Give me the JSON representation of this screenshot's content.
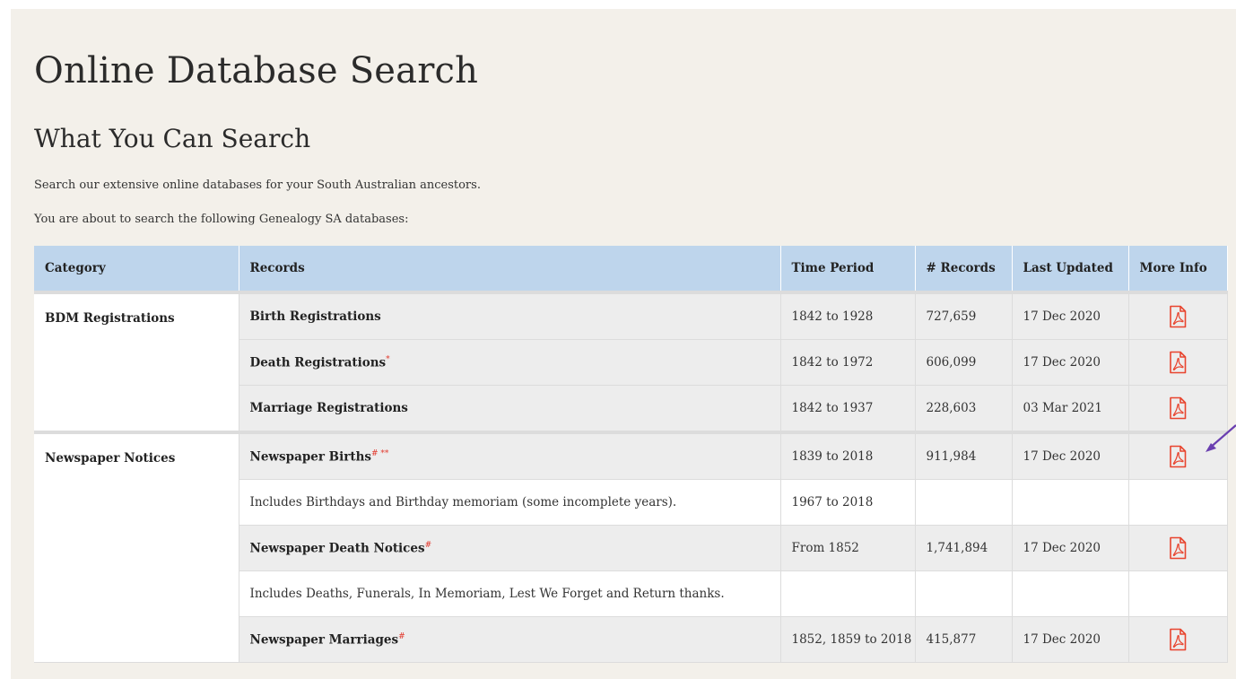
{
  "page": {
    "title": "Online Database Search",
    "subtitle": "What You Can Search",
    "intro_1": "Search our extensive online databases for your South Australian ancestors.",
    "intro_2": "You are about to search the following Genealogy SA databases:"
  },
  "table": {
    "headers": {
      "category": "Category",
      "records": "Records",
      "time_period": "Time Period",
      "num_records": "# Records",
      "last_updated": "Last Updated",
      "more_info": "More Info"
    },
    "groups": [
      {
        "category": "BDM Registrations",
        "rows": [
          {
            "record": "Birth Registrations",
            "marks": "",
            "period": "1842 to 1928",
            "count": "727,659",
            "updated": "17 Dec 2020",
            "pdf": true
          },
          {
            "record": "Death Registrations",
            "marks": "*",
            "period": "1842 to 1972",
            "count": "606,099",
            "updated": "17 Dec 2020",
            "pdf": true
          },
          {
            "record": "Marriage Registrations",
            "marks": "",
            "period": "1842 to 1937",
            "count": "228,603",
            "updated": "03 Mar 2021",
            "pdf": true
          }
        ]
      },
      {
        "category": "Newspaper Notices",
        "rows": [
          {
            "record": "Newspaper Births",
            "marks": "# **",
            "period": "1839 to 2018",
            "count": "911,984",
            "updated": "17 Dec 2020",
            "pdf": true
          },
          {
            "note": "Includes Birthdays and Birthday memoriam (some incomplete years).",
            "period": "1967 to 2018"
          },
          {
            "record": "Newspaper Death Notices",
            "marks": "#",
            "period": "From 1852",
            "count": "1,741,894",
            "updated": "17 Dec 2020",
            "pdf": true
          },
          {
            "note": "Includes Deaths, Funerals, In Memoriam, Lest We Forget and Return thanks.",
            "period": ""
          },
          {
            "record": "Newspaper Marriages",
            "marks": "#",
            "period": "1852, 1859 to 2018",
            "count": "415,877",
            "updated": "17 Dec 2020",
            "pdf": true
          }
        ]
      }
    ]
  },
  "icons": {
    "more_info": "pdf-icon",
    "annotation": "arrow-icon"
  },
  "colors": {
    "header_bg": "#bed5ec",
    "pdf_red": "#e8452f",
    "arrow": "#6a3fb0",
    "panel_bg": "#f3f0ea"
  }
}
